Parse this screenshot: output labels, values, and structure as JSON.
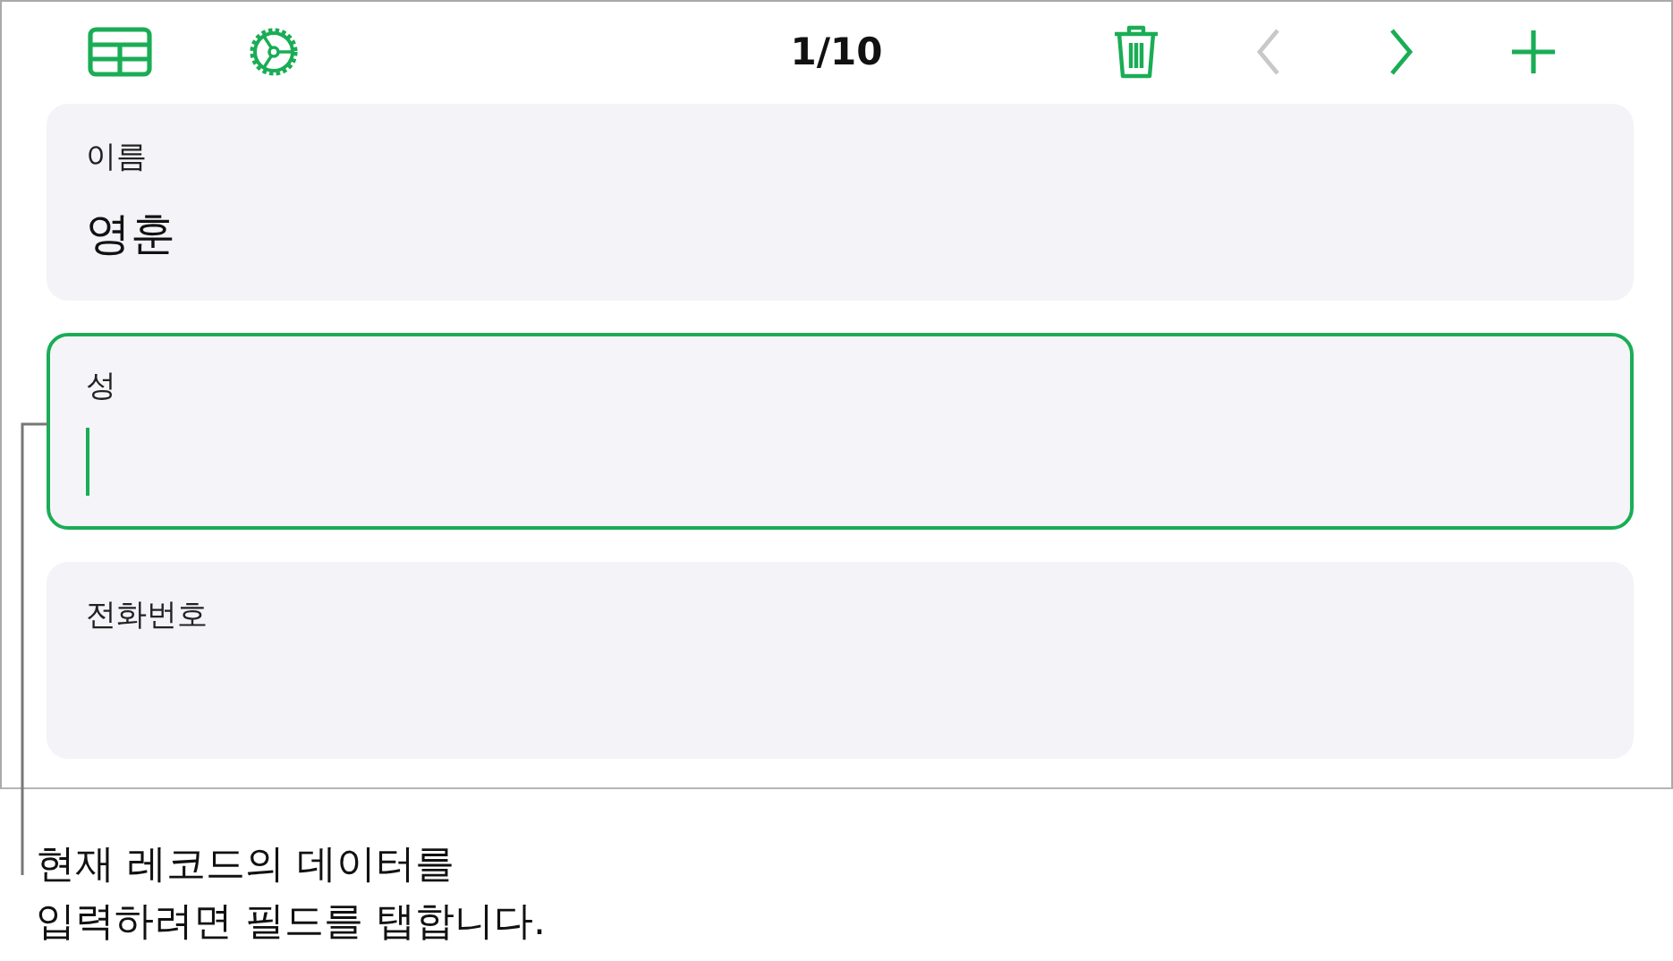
{
  "toolbar": {
    "record_counter": "1/10",
    "previous": {
      "disabled": true
    },
    "next": {
      "disabled": false
    }
  },
  "fields": [
    {
      "label": "이름",
      "value": "영훈",
      "focused": false
    },
    {
      "label": "성",
      "focused": true
    },
    {
      "label": "전화번호",
      "focused": false
    }
  ],
  "callout": "현재 레코드의 데이터를\n입력하려면 필드를 탭합니다."
}
